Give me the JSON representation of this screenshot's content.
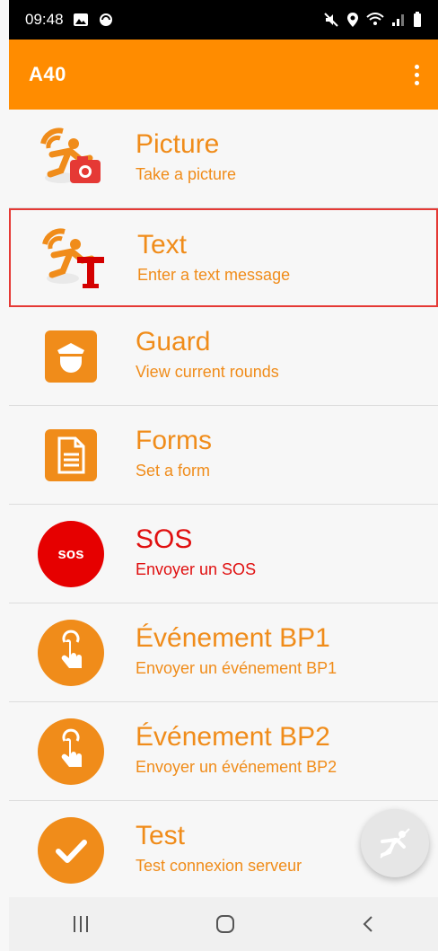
{
  "status": {
    "time": "09:48"
  },
  "appbar": {
    "title": "A40"
  },
  "items": [
    {
      "title": "Picture",
      "subtitle": "Take a picture"
    },
    {
      "title": "Text",
      "subtitle": "Enter a text message"
    },
    {
      "title": "Guard",
      "subtitle": "View current rounds"
    },
    {
      "title": "Forms",
      "subtitle": "Set a form"
    },
    {
      "title": "SOS",
      "subtitle": "Envoyer un SOS",
      "badge": "sos"
    },
    {
      "title": "Événement BP1",
      "subtitle": "Envoyer un événement BP1"
    },
    {
      "title": "Événement BP2",
      "subtitle": "Envoyer un événement BP2"
    },
    {
      "title": "Test",
      "subtitle": "Test connexion serveur"
    }
  ],
  "colors": {
    "accent": "#ff8c00",
    "text_orange": "#f08c1a",
    "sos_red": "#e01010",
    "selection": "#e53935"
  }
}
